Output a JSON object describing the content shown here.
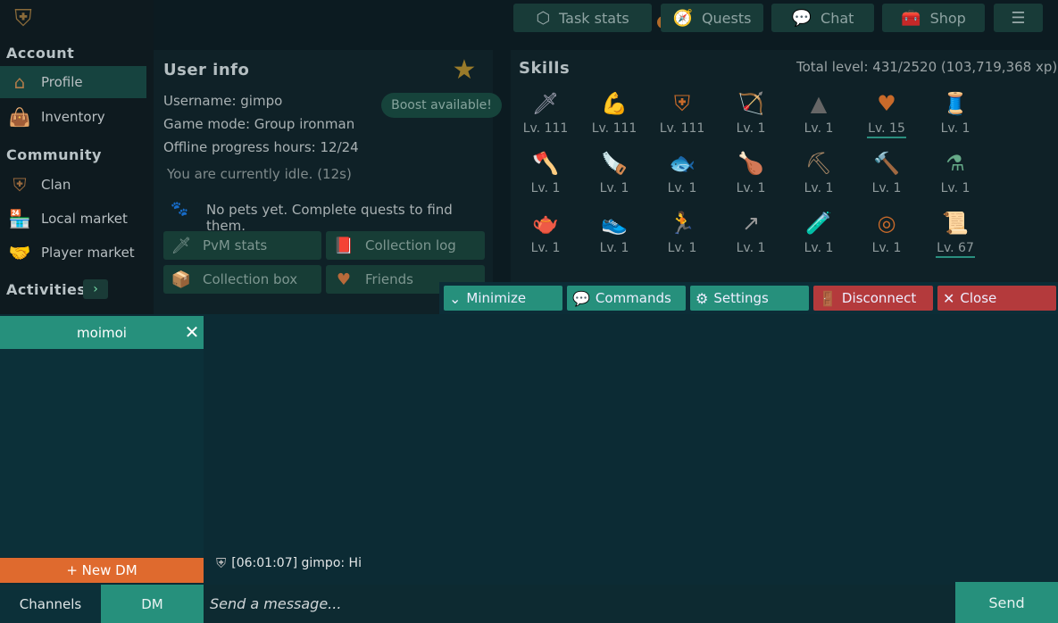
{
  "sidebar": {
    "account_heading": "Account",
    "community_heading": "Community",
    "activities_heading": "Activities",
    "items": [
      {
        "label": "Profile",
        "icon": "house-icon"
      },
      {
        "label": "Inventory",
        "icon": "bag-icon"
      },
      {
        "label": "Clan",
        "icon": "shield-icon"
      },
      {
        "label": "Local market",
        "icon": "shop-icon"
      },
      {
        "label": "Player market",
        "icon": "handshake-icon"
      }
    ]
  },
  "topbar": {
    "task_stats": "Task stats",
    "quests": "Quests",
    "chat": "Chat",
    "shop": "Shop"
  },
  "user_info": {
    "title": "User info",
    "username": "Username: gimpo",
    "game_mode": "Game mode: Group ironman",
    "offline_hours": "Offline progress hours: 12/24",
    "boost": "Boost available!",
    "idle_status": "You are currently idle. (12s)",
    "pets": "No pets yet. Complete quests to find them.",
    "buttons": {
      "pvm_stats": "PvM stats",
      "collection_log": "Collection log",
      "collection_box": "Collection box",
      "friends": "Friends"
    }
  },
  "skills": {
    "title": "Skills",
    "total": "Total level: 431/2520 (103,719,368 xp)",
    "rows": [
      [
        "Lv. 111",
        "Lv. 111",
        "Lv. 111",
        "Lv. 1",
        "Lv. 1",
        "Lv. 15",
        "Lv. 1"
      ],
      [
        "Lv. 1",
        "Lv. 1",
        "Lv. 1",
        "Lv. 1",
        "Lv. 1",
        "Lv. 1",
        "Lv. 1"
      ],
      [
        "Lv. 1",
        "Lv. 1",
        "Lv. 1",
        "Lv. 1",
        "Lv. 1",
        "Lv. 1",
        "Lv. 67"
      ]
    ]
  },
  "controls": {
    "minimize": "Minimize",
    "commands": "Commands",
    "settings": "Settings",
    "disconnect": "Disconnect",
    "close": "Close"
  },
  "chat": {
    "dm_tab": "moimoi",
    "new_dm": "+ New DM",
    "tab_channels": "Channels",
    "tab_dm": "DM",
    "placeholder": "Send a message...",
    "send": "Send",
    "messages": [
      {
        "text": "[06:01:07] gimpo: Hi"
      }
    ]
  },
  "colors": {
    "accent_teal": "#26907c",
    "danger_red": "#b43a3c",
    "new_dm_orange": "#df6a2e",
    "background": "#0c1b21"
  }
}
